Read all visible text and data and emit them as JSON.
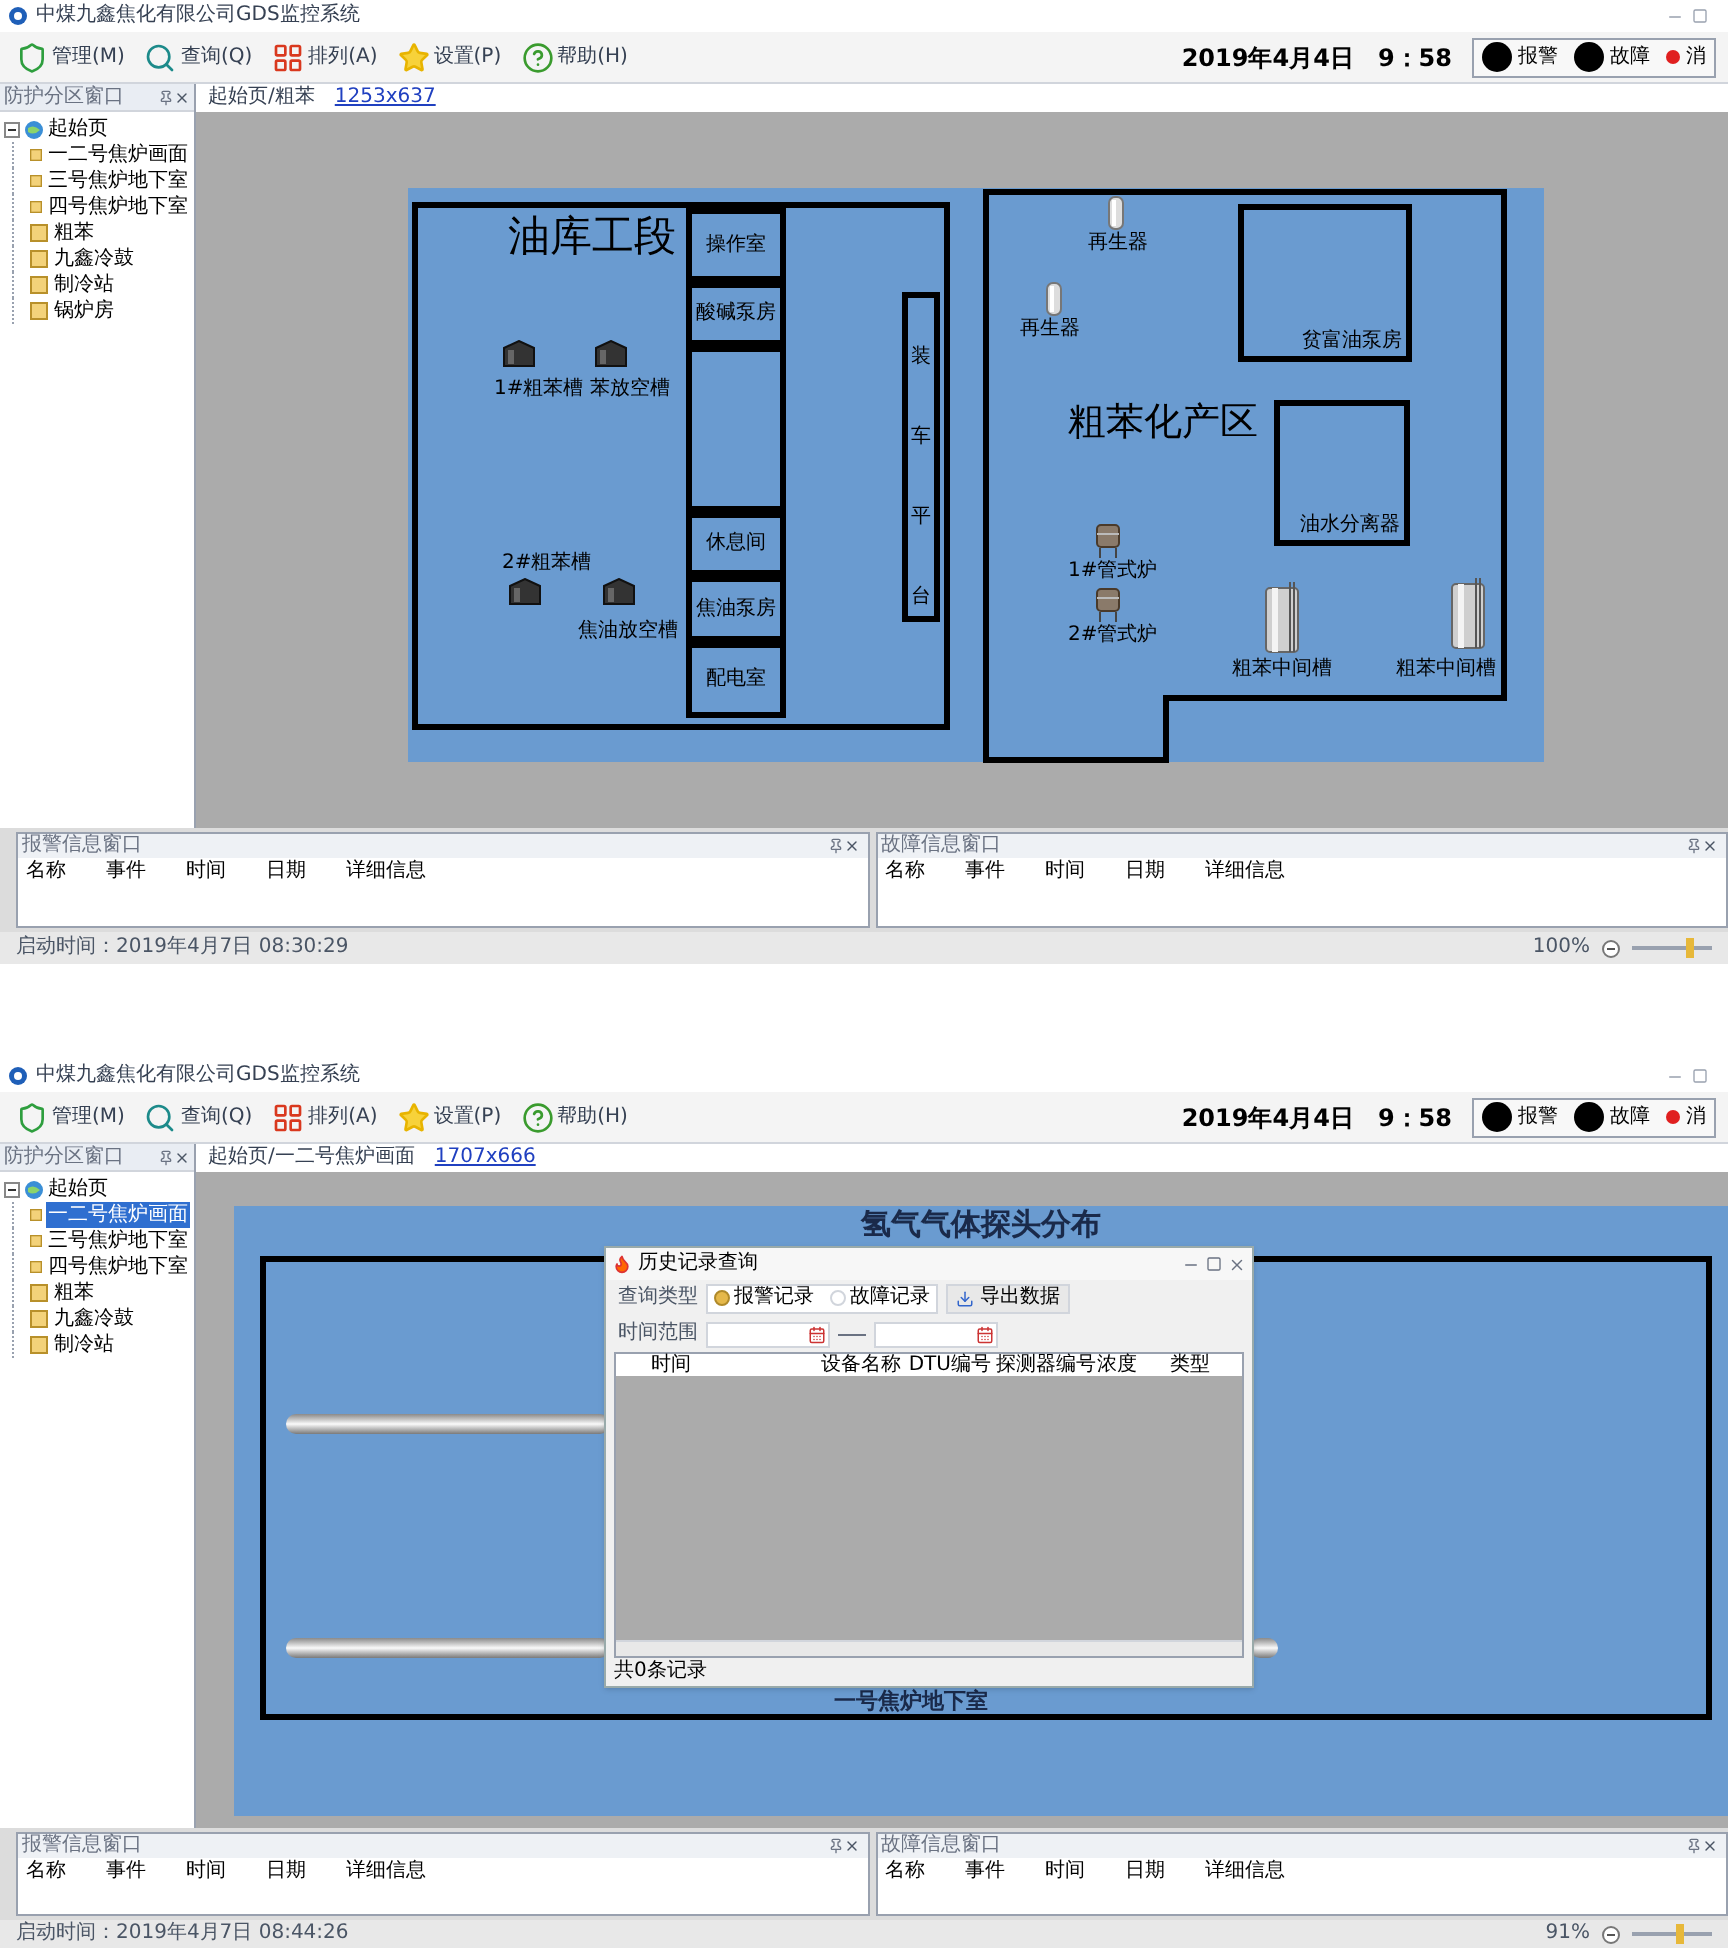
{
  "screens": [
    {
      "title": "中煤九鑫焦化有限公司GDS监控系统",
      "menu": [
        "管理(M)",
        "查询(Q)",
        "排列(A)",
        "设置(P)",
        "帮助(H)"
      ],
      "date": "2019年4月4日",
      "time": "9：58",
      "indicators": [
        {
          "label": "报警",
          "kind": "lamp"
        },
        {
          "label": "故障",
          "kind": "lamp"
        },
        {
          "label": "消",
          "kind": "mute"
        }
      ],
      "side_panel": {
        "title": "防护分区窗口",
        "tree": {
          "label": "起始页",
          "expanded": true,
          "children": [
            {
              "label": "一二号焦炉画面",
              "selected": false
            },
            {
              "label": "三号焦炉地下室",
              "selected": false
            },
            {
              "label": "四号焦炉地下室",
              "selected": false
            },
            {
              "label": "粗苯",
              "selected": false
            },
            {
              "label": "九鑫冷鼓",
              "selected": false
            },
            {
              "label": "制冷站",
              "selected": false
            },
            {
              "label": "锅炉房",
              "selected": false
            }
          ]
        }
      },
      "breadcrumb": {
        "path": "起始页/粗苯",
        "size_link": "1253x637"
      },
      "canvas": {
        "kind": "plant_map",
        "oil_depot": {
          "title": "油库工段",
          "rooms": [
            "操作室",
            "酸碱泵房",
            "休息间",
            "焦油泵房",
            "配电室"
          ],
          "loading_platform": "装车平台",
          "tank_labels": [
            "1#粗苯槽",
            "苯放空槽",
            "2#粗苯槽",
            "焦油放空槽"
          ]
        },
        "process_area": {
          "title": "粗苯化产区",
          "rooms": [
            "贫富油泵房",
            "油水分离器"
          ],
          "equipment": [
            {
              "kind": "regenerator",
              "label": "再生器"
            },
            {
              "kind": "regenerator",
              "label": "再生器"
            },
            {
              "kind": "furnace",
              "label": "1#管式炉"
            },
            {
              "kind": "furnace",
              "label": "2#管式炉"
            },
            {
              "kind": "tank",
              "label": "粗苯中间槽"
            },
            {
              "kind": "tank",
              "label": "粗苯中间槽"
            }
          ]
        }
      },
      "panels": [
        {
          "title": "报警信息窗口",
          "columns": [
            "名称",
            "事件",
            "时间",
            "日期",
            "详细信息"
          ]
        },
        {
          "title": "故障信息窗口",
          "columns": [
            "名称",
            "事件",
            "时间",
            "日期",
            "详细信息"
          ]
        }
      ],
      "status": {
        "started": "启动时间：2019年4月7日 08:30:29",
        "zoom": "100%",
        "level": 0.75
      }
    },
    {
      "title": "中煤九鑫焦化有限公司GDS监控系统",
      "menu": [
        "管理(M)",
        "查询(Q)",
        "排列(A)",
        "设置(P)",
        "帮助(H)"
      ],
      "date": "2019年4月4日",
      "time": "9：58",
      "indicators": [
        {
          "label": "报警",
          "kind": "lamp"
        },
        {
          "label": "故障",
          "kind": "lamp"
        },
        {
          "label": "消",
          "kind": "mute"
        }
      ],
      "side_panel": {
        "title": "防护分区窗口",
        "tree": {
          "label": "起始页",
          "expanded": true,
          "children": [
            {
              "label": "一二号焦炉画面",
              "selected": true
            },
            {
              "label": "三号焦炉地下室",
              "selected": false
            },
            {
              "label": "四号焦炉地下室",
              "selected": false
            },
            {
              "label": "粗苯",
              "selected": false
            },
            {
              "label": "九鑫冷鼓",
              "selected": false
            },
            {
              "label": "制冷站",
              "selected": false
            }
          ]
        }
      },
      "breadcrumb": {
        "path": "起始页/一二号焦炉画面",
        "size_link": "1707x666"
      },
      "canvas": {
        "kind": "probe_map",
        "title": "氢气气体探头分布",
        "footer": "一号焦炉地下室"
      },
      "dialog": {
        "title": "历史记录查询",
        "query_label": "查询类型",
        "query_types": [
          {
            "label": "报警记录",
            "selected": true
          },
          {
            "label": "故障记录",
            "selected": false
          }
        ],
        "export": "导出数据",
        "range_label": "时间范围",
        "columns": [
          "时间",
          "设备名称",
          "DTU编号",
          "探测器编号",
          "浓度",
          "类型"
        ],
        "footer": "共0条记录"
      },
      "panels": [
        {
          "title": "报警信息窗口",
          "columns": [
            "名称",
            "事件",
            "时间",
            "日期",
            "详细信息"
          ]
        },
        {
          "title": "故障信息窗口",
          "columns": [
            "名称",
            "事件",
            "时间",
            "日期",
            "详细信息"
          ]
        }
      ],
      "status": {
        "started": "启动时间：2019年4月7日 08:44:26",
        "zoom": "91%",
        "level": 0.6
      }
    }
  ]
}
